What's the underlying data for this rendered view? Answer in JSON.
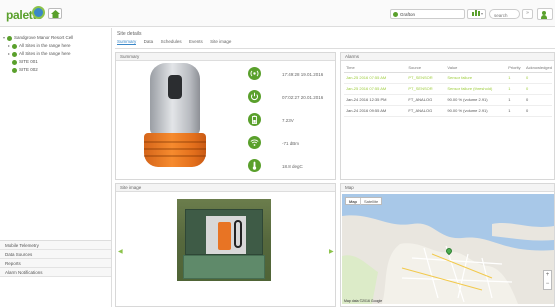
{
  "header": {
    "logo_text": "palette",
    "site_selector": "Grafton",
    "search_placeholder": "search",
    "search_go": "»",
    "accent_color": "#5aa02c"
  },
  "sidebar": {
    "tree": [
      {
        "label": "Sandgrove Manor Resort Cell",
        "level": 0
      },
      {
        "label": "All Sites in the range here",
        "level": 1
      },
      {
        "label": "All Sites in the range here",
        "level": 1
      },
      {
        "label": "SITE 001",
        "level": 1
      },
      {
        "label": "SITE 002",
        "level": 1
      }
    ],
    "links": [
      "Mobile Telemetry",
      "Data Sources",
      "Reports",
      "Alarm Notifications"
    ]
  },
  "main": {
    "title": "Site details",
    "tabs": [
      {
        "label": "Summary",
        "active": true
      },
      {
        "label": "Data",
        "active": false
      },
      {
        "label": "Schedules",
        "active": false
      },
      {
        "label": "Events",
        "active": false
      },
      {
        "label": "Site image",
        "active": false
      }
    ]
  },
  "summary_panel": {
    "title": "Summary",
    "statuses": [
      {
        "icon": "signal-icon",
        "text": "17:49:28 19.01.2016"
      },
      {
        "icon": "power-icon",
        "text": "07:02:27 20.01.2016"
      },
      {
        "icon": "battery-icon",
        "text": "7.23V"
      },
      {
        "icon": "wifi-icon",
        "text": "-71 dBm"
      },
      {
        "icon": "thermometer-icon",
        "text": "18.8 degC"
      }
    ]
  },
  "alarms_panel": {
    "title": "Alarms",
    "columns": [
      "Time",
      "Source",
      "Value",
      "Priority",
      "Acknowledged"
    ],
    "rows": [
      {
        "time": "Jan-25 2016 07:55 AM",
        "source": "PT_SENSOR",
        "value": "Sensor failure",
        "priority": "1",
        "ack": "0",
        "warn": true
      },
      {
        "time": "Jan-25 2016 07:55 AM",
        "source": "PT_SENSOR",
        "value": "Sensor failure (threshold)",
        "priority": "1",
        "ack": "0",
        "warn": true
      },
      {
        "time": "Jan-24 2016 12:35 PM",
        "source": "FT_ANALOG",
        "value": "90.00 % (volume 2.91)",
        "priority": "1",
        "ack": "0",
        "warn": false
      },
      {
        "time": "Jan-24 2016 09:55 AM",
        "source": "FT_ANALOG",
        "value": "90.00 % (volume 2.91)",
        "priority": "1",
        "ack": "0",
        "warn": false
      }
    ]
  },
  "image_panel": {
    "title": "Site image",
    "prev": "◀",
    "next": "▶"
  },
  "map_panel": {
    "title": "Map",
    "map_type_buttons": [
      "Map",
      "Satellite"
    ],
    "zoom_in": "+",
    "zoom_out": "−",
    "attribution": "Map data ©2016 Google"
  }
}
